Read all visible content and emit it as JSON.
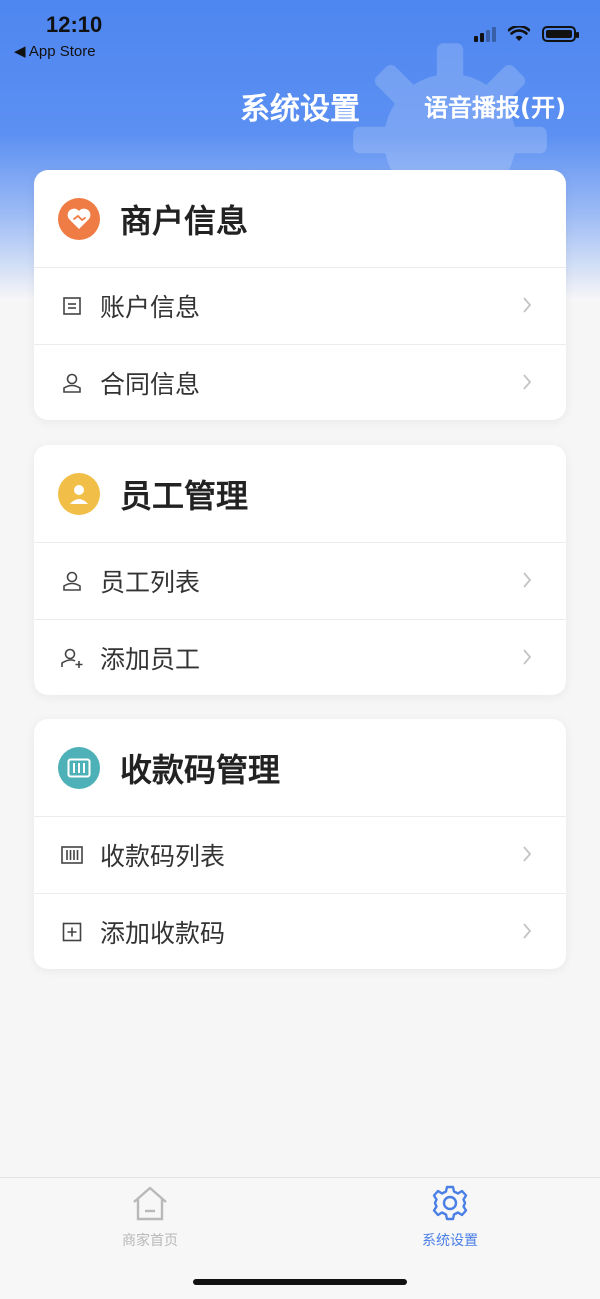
{
  "status_bar": {
    "time": "12:10",
    "back_app": "◀ App Store"
  },
  "header": {
    "title": "系统设置",
    "voice_toggle": "语音播报(开)"
  },
  "sections": [
    {
      "title": "商户信息",
      "badge_color": "#f07c45",
      "badge_icon": "handshake-icon",
      "rows": [
        {
          "label": "账户信息",
          "icon": "account-doc-icon"
        },
        {
          "label": "合同信息",
          "icon": "person-icon"
        }
      ]
    },
    {
      "title": "员工管理",
      "badge_color": "#f1be48",
      "badge_icon": "user-icon",
      "rows": [
        {
          "label": "员工列表",
          "icon": "person-icon"
        },
        {
          "label": "添加员工",
          "icon": "person-add-icon"
        }
      ]
    },
    {
      "title": "收款码管理",
      "badge_color": "#4fb1b8",
      "badge_icon": "barcode-icon",
      "rows": [
        {
          "label": "收款码列表",
          "icon": "barcode-icon"
        },
        {
          "label": "添加收款码",
          "icon": "plus-square-icon"
        }
      ]
    }
  ],
  "tabbar": {
    "tabs": [
      {
        "label": "商家首页",
        "icon": "home-icon",
        "active": false
      },
      {
        "label": "系统设置",
        "icon": "gear-icon",
        "active": true
      }
    ],
    "active_color": "#4a7fe6",
    "inactive_color": "#b9b9b9"
  }
}
